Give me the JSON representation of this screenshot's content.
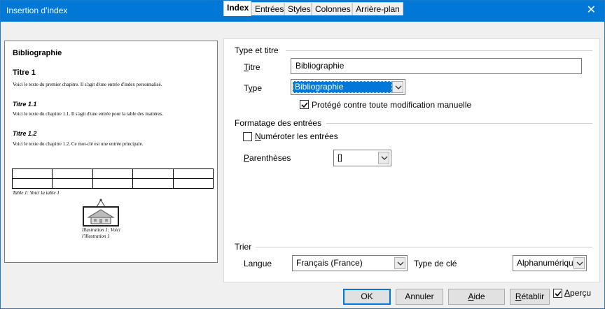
{
  "window": {
    "title": "Insertion d’index",
    "close_glyph": "✕"
  },
  "preview": {
    "heading": "Bibliographie",
    "title1": "Titre 1",
    "text1": "Voici le texte du premier chapitre. Il s'agit d'une entrée d'index personnalisé.",
    "title11": "Titre 1.1",
    "text11": "Voici le texte du chapitre 1.1. Il s'agit d'une entrée pour la table des matières.",
    "title12": "Titre 1.2",
    "text12": "Voici le texte du chapitre 1.2. Ce mot-clé est une entrée principale.",
    "table_caption": "Table 1: Voici la table 1",
    "illus_caption1": "Illustration 1: Voici",
    "illus_caption2": "l'illustration 1"
  },
  "tabs": [
    {
      "label": "Index",
      "active": true
    },
    {
      "label": "Entrées",
      "active": false
    },
    {
      "label": "Styles",
      "active": false
    },
    {
      "label": "Colonnes",
      "active": false
    },
    {
      "label": "Arrière-plan",
      "active": false
    }
  ],
  "type_titre": {
    "section_label": "Type et titre",
    "titre_label_pre": "",
    "titre_label_u": "T",
    "titre_label_post": "itre",
    "titre_value": "Bibliographie",
    "type_label_pre": "T",
    "type_label_u": "y",
    "type_label_post": "pe",
    "type_value": "Bibliographie",
    "protege_label_pre": "Proté",
    "protege_label_u": "g",
    "protege_label_post": "é contre toute modification manuelle",
    "protege_checked": true
  },
  "formatage": {
    "section_label": "Formatage des entrées",
    "numeroter_label_pre": "",
    "numeroter_label_u": "N",
    "numeroter_label_post": "uméroter les entrées",
    "numeroter_checked": false,
    "parentheses_label_pre": "",
    "parentheses_label_u": "P",
    "parentheses_label_post": "arenthèses",
    "parentheses_value": "[]"
  },
  "trier": {
    "section_label": "Trier",
    "langue_label": "Langue",
    "langue_value": "Français (France)",
    "type_cle_label": "Type de clé",
    "type_cle_value": "Alphanumérique"
  },
  "buttons": {
    "ok": "OK",
    "annuler": "Annuler",
    "aide_pre": "",
    "aide_u": "A",
    "aide_post": "ide",
    "retablir_pre": "",
    "retablir_u": "R",
    "retablir_post": "établir",
    "apercu_pre": "",
    "apercu_u": "A",
    "apercu_post": "perçu",
    "apercu_checked": true
  },
  "colors": {
    "titlebar": "#0078d7",
    "selection": "#0078d7",
    "accent_border": "#0078d7"
  }
}
